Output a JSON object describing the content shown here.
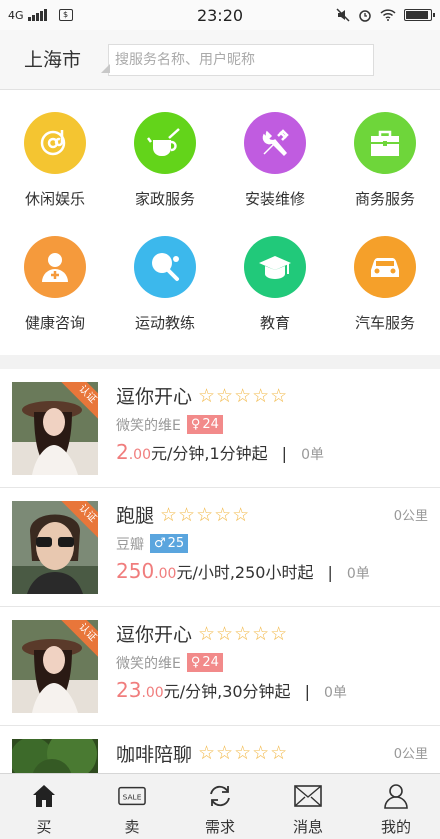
{
  "status_bar": {
    "network": "4G",
    "time": "23:20",
    "battery_level": 0.85
  },
  "header": {
    "city": "上海市",
    "search_placeholder": "搜服务名称、用户昵称"
  },
  "categories": [
    {
      "label": "休闲娱乐",
      "color": "#f4c531",
      "icon": "music-disc-icon"
    },
    {
      "label": "家政服务",
      "color": "#63d41a",
      "icon": "teapot-broom-icon"
    },
    {
      "label": "安装维修",
      "color": "#c05ce0",
      "icon": "wrench-tools-icon"
    },
    {
      "label": "商务服务",
      "color": "#6ed63a",
      "icon": "briefcase-icon"
    },
    {
      "label": "健康咨询",
      "color": "#f59a3c",
      "icon": "medical-person-icon"
    },
    {
      "label": "运动教练",
      "color": "#3cb8ec",
      "icon": "ping-pong-icon"
    },
    {
      "label": "教育",
      "color": "#21c97a",
      "icon": "graduation-cap-icon"
    },
    {
      "label": "汽车服务",
      "color": "#f5a02a",
      "icon": "car-icon"
    }
  ],
  "listings": [
    {
      "name": "逗你开心",
      "stars": "☆☆☆☆☆",
      "subtitle": "微笑的维E",
      "gender": "female",
      "age": "24",
      "price_int": "2",
      "price_dec": ".00",
      "price_unit": "元/分钟,1分钟起",
      "separator": "|",
      "orders": "0单",
      "distance": "",
      "badge": "认证",
      "photo": "woman-hat"
    },
    {
      "name": "跑腿",
      "stars": "☆☆☆☆☆",
      "subtitle": "豆瓣",
      "gender": "male",
      "age": "25",
      "price_int": "250",
      "price_dec": ".00",
      "price_unit": "元/小时,250小时起",
      "separator": "|",
      "orders": "0单",
      "distance": "0公里",
      "badge": "认证",
      "photo": "man-sunglasses"
    },
    {
      "name": "逗你开心",
      "stars": "☆☆☆☆☆",
      "subtitle": "微笑的维E",
      "gender": "female",
      "age": "24",
      "price_int": "23",
      "price_dec": ".00",
      "price_unit": "元/分钟,30分钟起",
      "separator": "|",
      "orders": "0单",
      "distance": "",
      "badge": "认证",
      "photo": "woman-hat"
    },
    {
      "name": "咖啡陪聊",
      "stars": "☆☆☆☆☆",
      "subtitle": "",
      "gender": "male",
      "age": "",
      "price_int": "",
      "price_dec": "",
      "price_unit": "",
      "separator": "",
      "orders": "",
      "distance": "0公里",
      "badge": "",
      "photo": "tree"
    }
  ],
  "tabs": [
    {
      "label": "买",
      "icon": "home-icon",
      "active": true
    },
    {
      "label": "卖",
      "icon": "sale-tag-icon",
      "active": false
    },
    {
      "label": "需求",
      "icon": "refresh-icon",
      "active": false
    },
    {
      "label": "消息",
      "icon": "mail-icon",
      "active": false
    },
    {
      "label": "我的",
      "icon": "person-icon",
      "active": false
    }
  ]
}
